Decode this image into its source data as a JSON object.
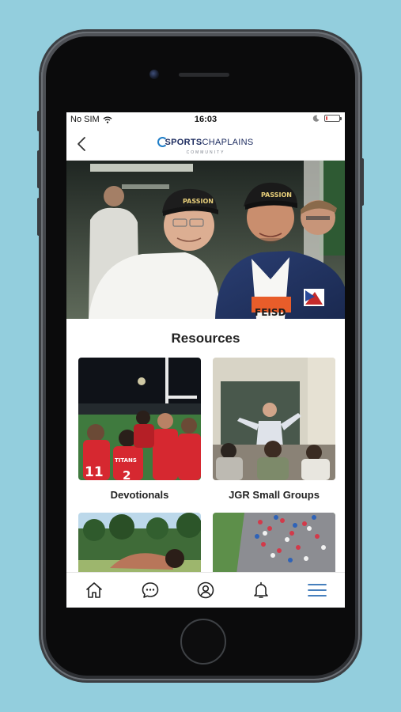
{
  "status_bar": {
    "carrier": "No SIM",
    "time": "16:03",
    "battery_level": 0.12,
    "battery_color": "#e14d4d"
  },
  "header": {
    "back_icon": "chevron-left-icon",
    "brand_sports": "SPORTS",
    "brand_chaplains": "CHAPLAINS",
    "brand_sub": "COMMUNITY"
  },
  "hero": {
    "cap_text_1": "PASSION",
    "cap_text_2": "PASSION",
    "shirt_text": "FEISD"
  },
  "resources": {
    "title": "Resources",
    "items": [
      {
        "label": "Devotionals",
        "jersey_number_1": "11",
        "jersey_number_2": "2",
        "jersey_text": "TITANS"
      },
      {
        "label": "JGR Small Groups"
      },
      {
        "label": ""
      },
      {
        "label": ""
      }
    ]
  },
  "tab_bar": {
    "items": [
      {
        "icon": "home-icon"
      },
      {
        "icon": "chat-icon"
      },
      {
        "icon": "profile-icon"
      },
      {
        "icon": "bell-icon"
      },
      {
        "icon": "menu-icon",
        "active": true
      }
    ],
    "active_color": "#2c6db4",
    "inactive_color": "#222222"
  },
  "colors": {
    "background": "#93cedd",
    "brand_blue": "#1f7ec8",
    "brand_navy": "#1b2a5e"
  }
}
